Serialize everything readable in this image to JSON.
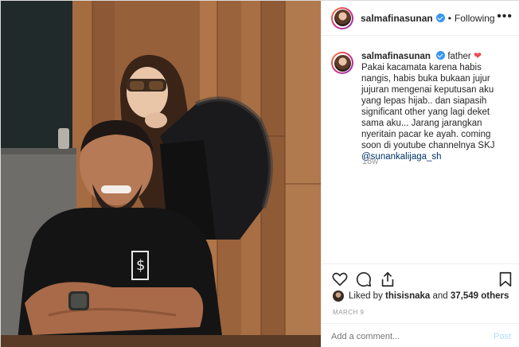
{
  "header": {
    "username": "salmafinasunan",
    "separator": "•",
    "follow_status": "Following",
    "more": "•••"
  },
  "caption": {
    "username": "salmafinasunan",
    "lead": "father",
    "heart": "❤",
    "body": "Pakai kacamata karena habis nangis, habis buka bukaan jujur jujuran mengenai keputusan aku yang lepas hijab.. dan siapasih significant other yang lagi deket sama aku... Jarang jarangkan nyeritain pacar ke ayah. coming soon di youtube channelnya SKJ",
    "mention": "@sunankalijaga_sh",
    "time": "18w"
  },
  "likes": {
    "prefix": "Liked by",
    "user": "thisisnaka",
    "and": "and",
    "count": "37,549 others"
  },
  "date": "MARCH 9",
  "add_comment": {
    "placeholder": "Add a comment...",
    "post_label": "Post"
  },
  "colors": {
    "verified": "#3897f0",
    "heart": "#ed4956",
    "mention": "#003569",
    "post_disabled": "#b3dbff"
  }
}
